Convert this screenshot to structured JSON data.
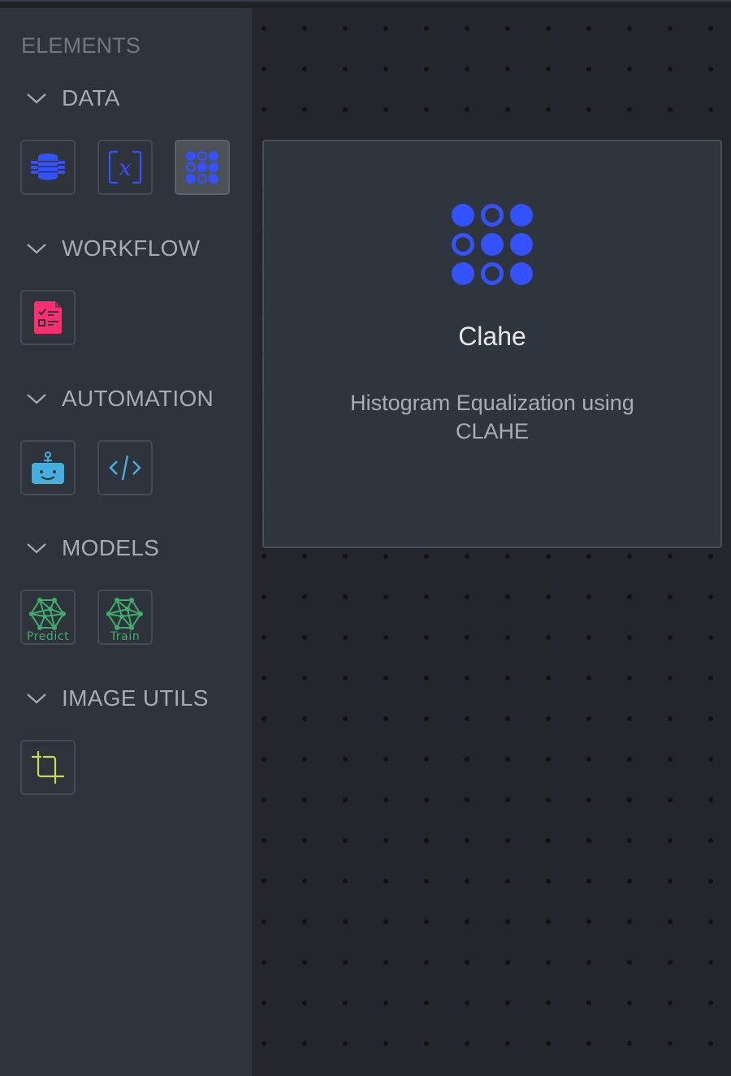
{
  "sidebar": {
    "title": "ELEMENTS",
    "sections": [
      {
        "label": "DATA",
        "expanded": true,
        "items": [
          {
            "name": "database",
            "icon": "database-icon",
            "color": "#3452ff",
            "selected": false
          },
          {
            "name": "variable",
            "icon": "variable-x-icon",
            "color": "#3452ff",
            "selected": false
          },
          {
            "name": "clahe",
            "icon": "dot-grid-icon",
            "color": "#3452ff",
            "selected": true
          }
        ]
      },
      {
        "label": "WORKFLOW",
        "expanded": true,
        "items": [
          {
            "name": "checklist",
            "icon": "checklist-document-icon",
            "color": "#ff2e6e",
            "selected": false
          }
        ]
      },
      {
        "label": "AUTOMATION",
        "expanded": true,
        "items": [
          {
            "name": "bot",
            "icon": "robot-icon",
            "color": "#45b0e0",
            "selected": false
          },
          {
            "name": "code",
            "icon": "code-icon",
            "color": "#45b0e0",
            "selected": false
          }
        ]
      },
      {
        "label": "MODELS",
        "expanded": true,
        "items": [
          {
            "name": "predict",
            "icon": "neural-network-icon",
            "caption": "Predict",
            "color": "#3fae6a",
            "selected": false
          },
          {
            "name": "train",
            "icon": "neural-network-icon",
            "caption": "Train",
            "color": "#3fae6a",
            "selected": false
          }
        ]
      },
      {
        "label": "IMAGE UTILS",
        "expanded": true,
        "items": [
          {
            "name": "crop",
            "icon": "crop-icon",
            "color": "#c8dc5a",
            "selected": false
          }
        ]
      }
    ]
  },
  "card": {
    "icon": "dot-grid-icon",
    "title": "Clahe",
    "description": "Histogram Equalization using CLAHE",
    "accent": "#3452ff"
  },
  "colors": {
    "accent_blue": "#3452ff",
    "workflow_pink": "#ff2e6e",
    "automation_cyan": "#45b0e0",
    "models_green": "#3fae6a",
    "image_utils_lime": "#c8dc5a"
  }
}
